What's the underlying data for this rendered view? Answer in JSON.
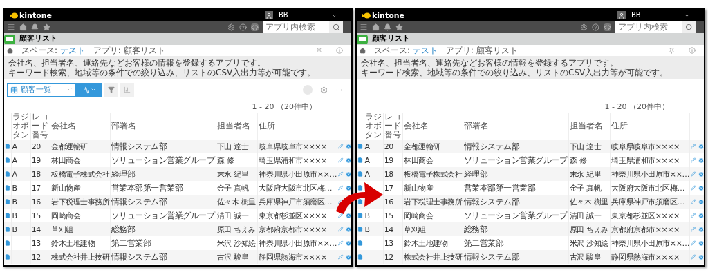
{
  "panels": [
    {
      "brand": "kintone",
      "user": "BB",
      "search": {
        "placeholder": "アプリ内検索"
      },
      "app_title": "顧客リスト",
      "breadcrumb": [
        {
          "label": "スペース: ",
          "link": "テスト"
        },
        {
          "label": "アプリ: 顧客リスト"
        }
      ],
      "description": [
        "会社名、担当者名、連絡先などお客様の情報を登録するアプリです。",
        "キーワード検索、地域等の条件での絞り込み、リストのCSV入出力等が可能です。"
      ],
      "toolbar": {
        "view": "顧客一覧"
      },
      "pagination": "1 - 20 （20件中）",
      "columns": [
        "ラジオボタン",
        "レコード番号",
        "会社名",
        "部署名",
        "担当者名",
        "住所"
      ],
      "rows": [
        {
          "cells": [
            "A",
            "20",
            "金都運輸研",
            "情報システム部",
            "下山 達士",
            "岐阜県岐阜市××××"
          ]
        },
        {
          "cells": [
            "A",
            "19",
            "林田商会",
            "ソリューション営業グループ",
            "森 修",
            "埼玉県浦和市××××"
          ]
        },
        {
          "cells": [
            "A",
            "18",
            "板橋電子株式会社",
            "経理部",
            "末永 紀里",
            "神奈川県小田原市××…"
          ]
        },
        {
          "cells": [
            "B",
            "17",
            "新山物産",
            "営業本部第一営業部",
            "金子 真帆",
            "大阪府大阪市北区梅…"
          ]
        },
        {
          "cells": [
            "B",
            "16",
            "岩下税理士事務所",
            "情報システム部",
            "佐々木 樹里",
            "兵庫県神戸市須磨区…"
          ]
        },
        {
          "cells": [
            "B",
            "15",
            "岡崎商会",
            "ソリューション営業グループ",
            "清田 誠一",
            "東京都杉並区××××"
          ]
        },
        {
          "cells": [
            "B",
            "14",
            "草刈組",
            "総務部",
            "原田 ちえみ",
            "京都府京都市××××"
          ]
        },
        {
          "cells": [
            "",
            "13",
            "鈴木土地建物",
            "第二営業部",
            "米沢 沙知絵",
            "神奈川県小田原市××…"
          ]
        },
        {
          "cells": [
            "",
            "12",
            "株式会社井上技研",
            "情報システム部",
            "古沢 駿皇",
            "静岡県熱海市××××"
          ]
        }
      ]
    },
    {
      "brand": "kintone",
      "user": "BB",
      "search": {
        "placeholder": "アプリ内検索"
      },
      "app_title": "顧客リスト",
      "breadcrumb": [
        {
          "label": "スペース: ",
          "link": "テスト"
        },
        {
          "label": "アプリ: 顧客リスト"
        }
      ],
      "description": [
        "会社名、担当者名、連絡先などお客様の情報を登録するアプリです。",
        "キーワード検索、地域等の条件での絞り込み、リストのCSV入出力等が可能です。"
      ],
      "pagination": "1 - 20 （20件中）",
      "columns": [
        "ラジオボタン",
        "レコード番号",
        "会社名",
        "部署名",
        "担当者名",
        "住所"
      ],
      "rows": [
        {
          "cells": [
            "A",
            "20",
            "金都運輸研",
            "情報システム部",
            "下山 達士",
            "岐阜県岐阜市××××"
          ]
        },
        {
          "cells": [
            "A",
            "19",
            "林田商会",
            "ソリューション営業グループ",
            "森 修",
            "埼玉県浦和市××××"
          ]
        },
        {
          "cells": [
            "A",
            "18",
            "板橋電子株式会社",
            "経理部",
            "末永 紀里",
            "神奈川県小田原市××…"
          ]
        },
        {
          "cells": [
            "",
            "17",
            "新山物産",
            "営業本部第一営業部",
            "金子 真帆",
            "大阪府大阪市北区梅…"
          ]
        },
        {
          "cells": [
            "",
            "16",
            "岩下税理士事務所",
            "情報システム部",
            "佐々木 樹里",
            "兵庫県神戸市須磨区…"
          ]
        },
        {
          "cells": [
            "B",
            "15",
            "岡崎商会",
            "ソリューション営業グループ",
            "清田 誠一",
            "東京都杉並区××××"
          ]
        },
        {
          "cells": [
            "B",
            "14",
            "草刈組",
            "総務部",
            "原田 ちえみ",
            "京都府京都市××××"
          ]
        },
        {
          "cells": [
            "",
            "13",
            "鈴木土地建物",
            "第二営業部",
            "米沢 沙知絵",
            "神奈川県小田原市××…"
          ]
        },
        {
          "cells": [
            "",
            "12",
            "株式会社井上技研",
            "情報システム部",
            "古沢 駿皇",
            "静岡県熱海市××××"
          ]
        }
      ]
    }
  ]
}
